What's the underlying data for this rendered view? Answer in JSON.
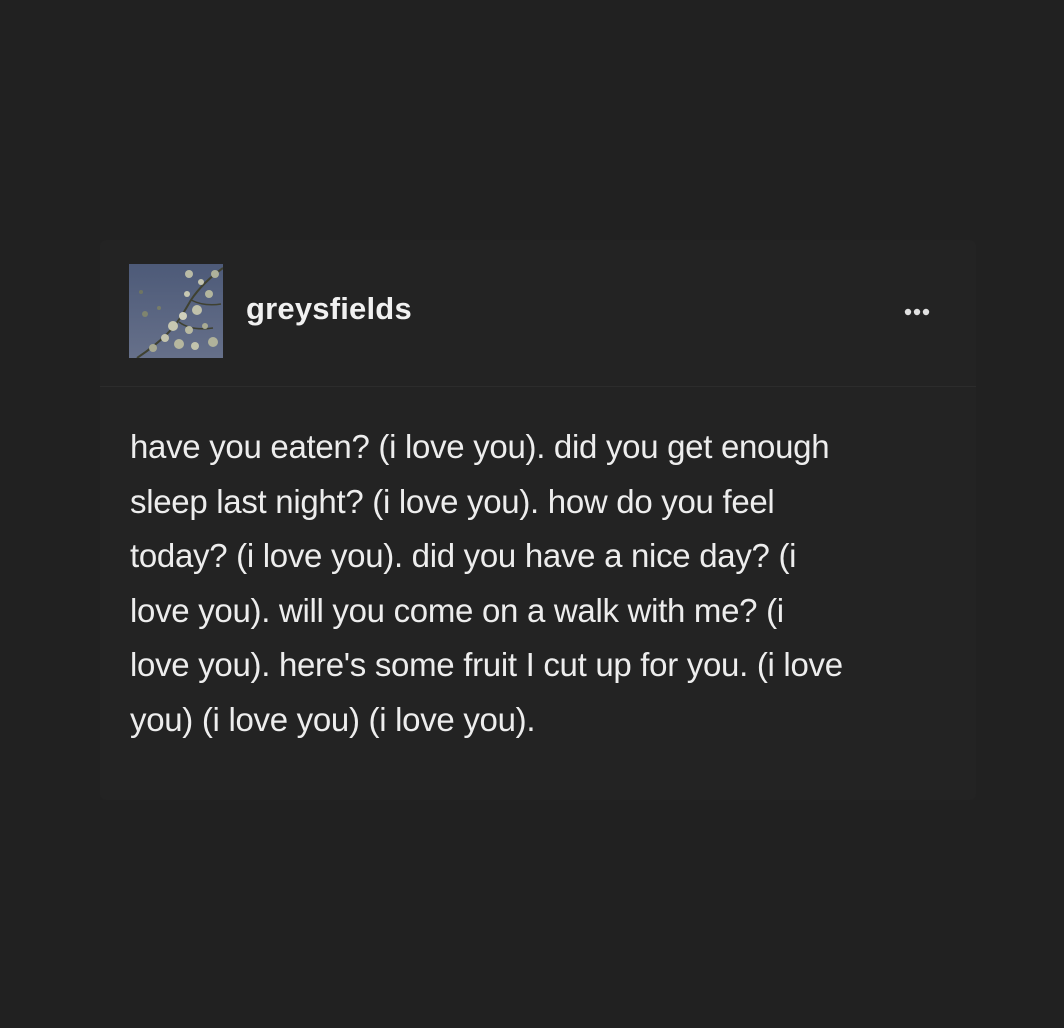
{
  "post": {
    "author": {
      "username": "greysfields",
      "avatar_icon": "avatar-photo-sky-branches"
    },
    "menu_icon": "more-options-icon",
    "body_lines": [
      "have you eaten? (i love you). did you get enough",
      "sleep last night? (i love you). how do you feel",
      "today? (i love you). did you have a nice day? (i",
      "love you). will you come on a walk with me? (i",
      "love you). here's some fruit I cut up for you. (i love",
      "you) (i love you) (i love you)."
    ]
  },
  "colors": {
    "background": "#212121",
    "text": "#ededed",
    "avatar_sky": "#57617c"
  }
}
